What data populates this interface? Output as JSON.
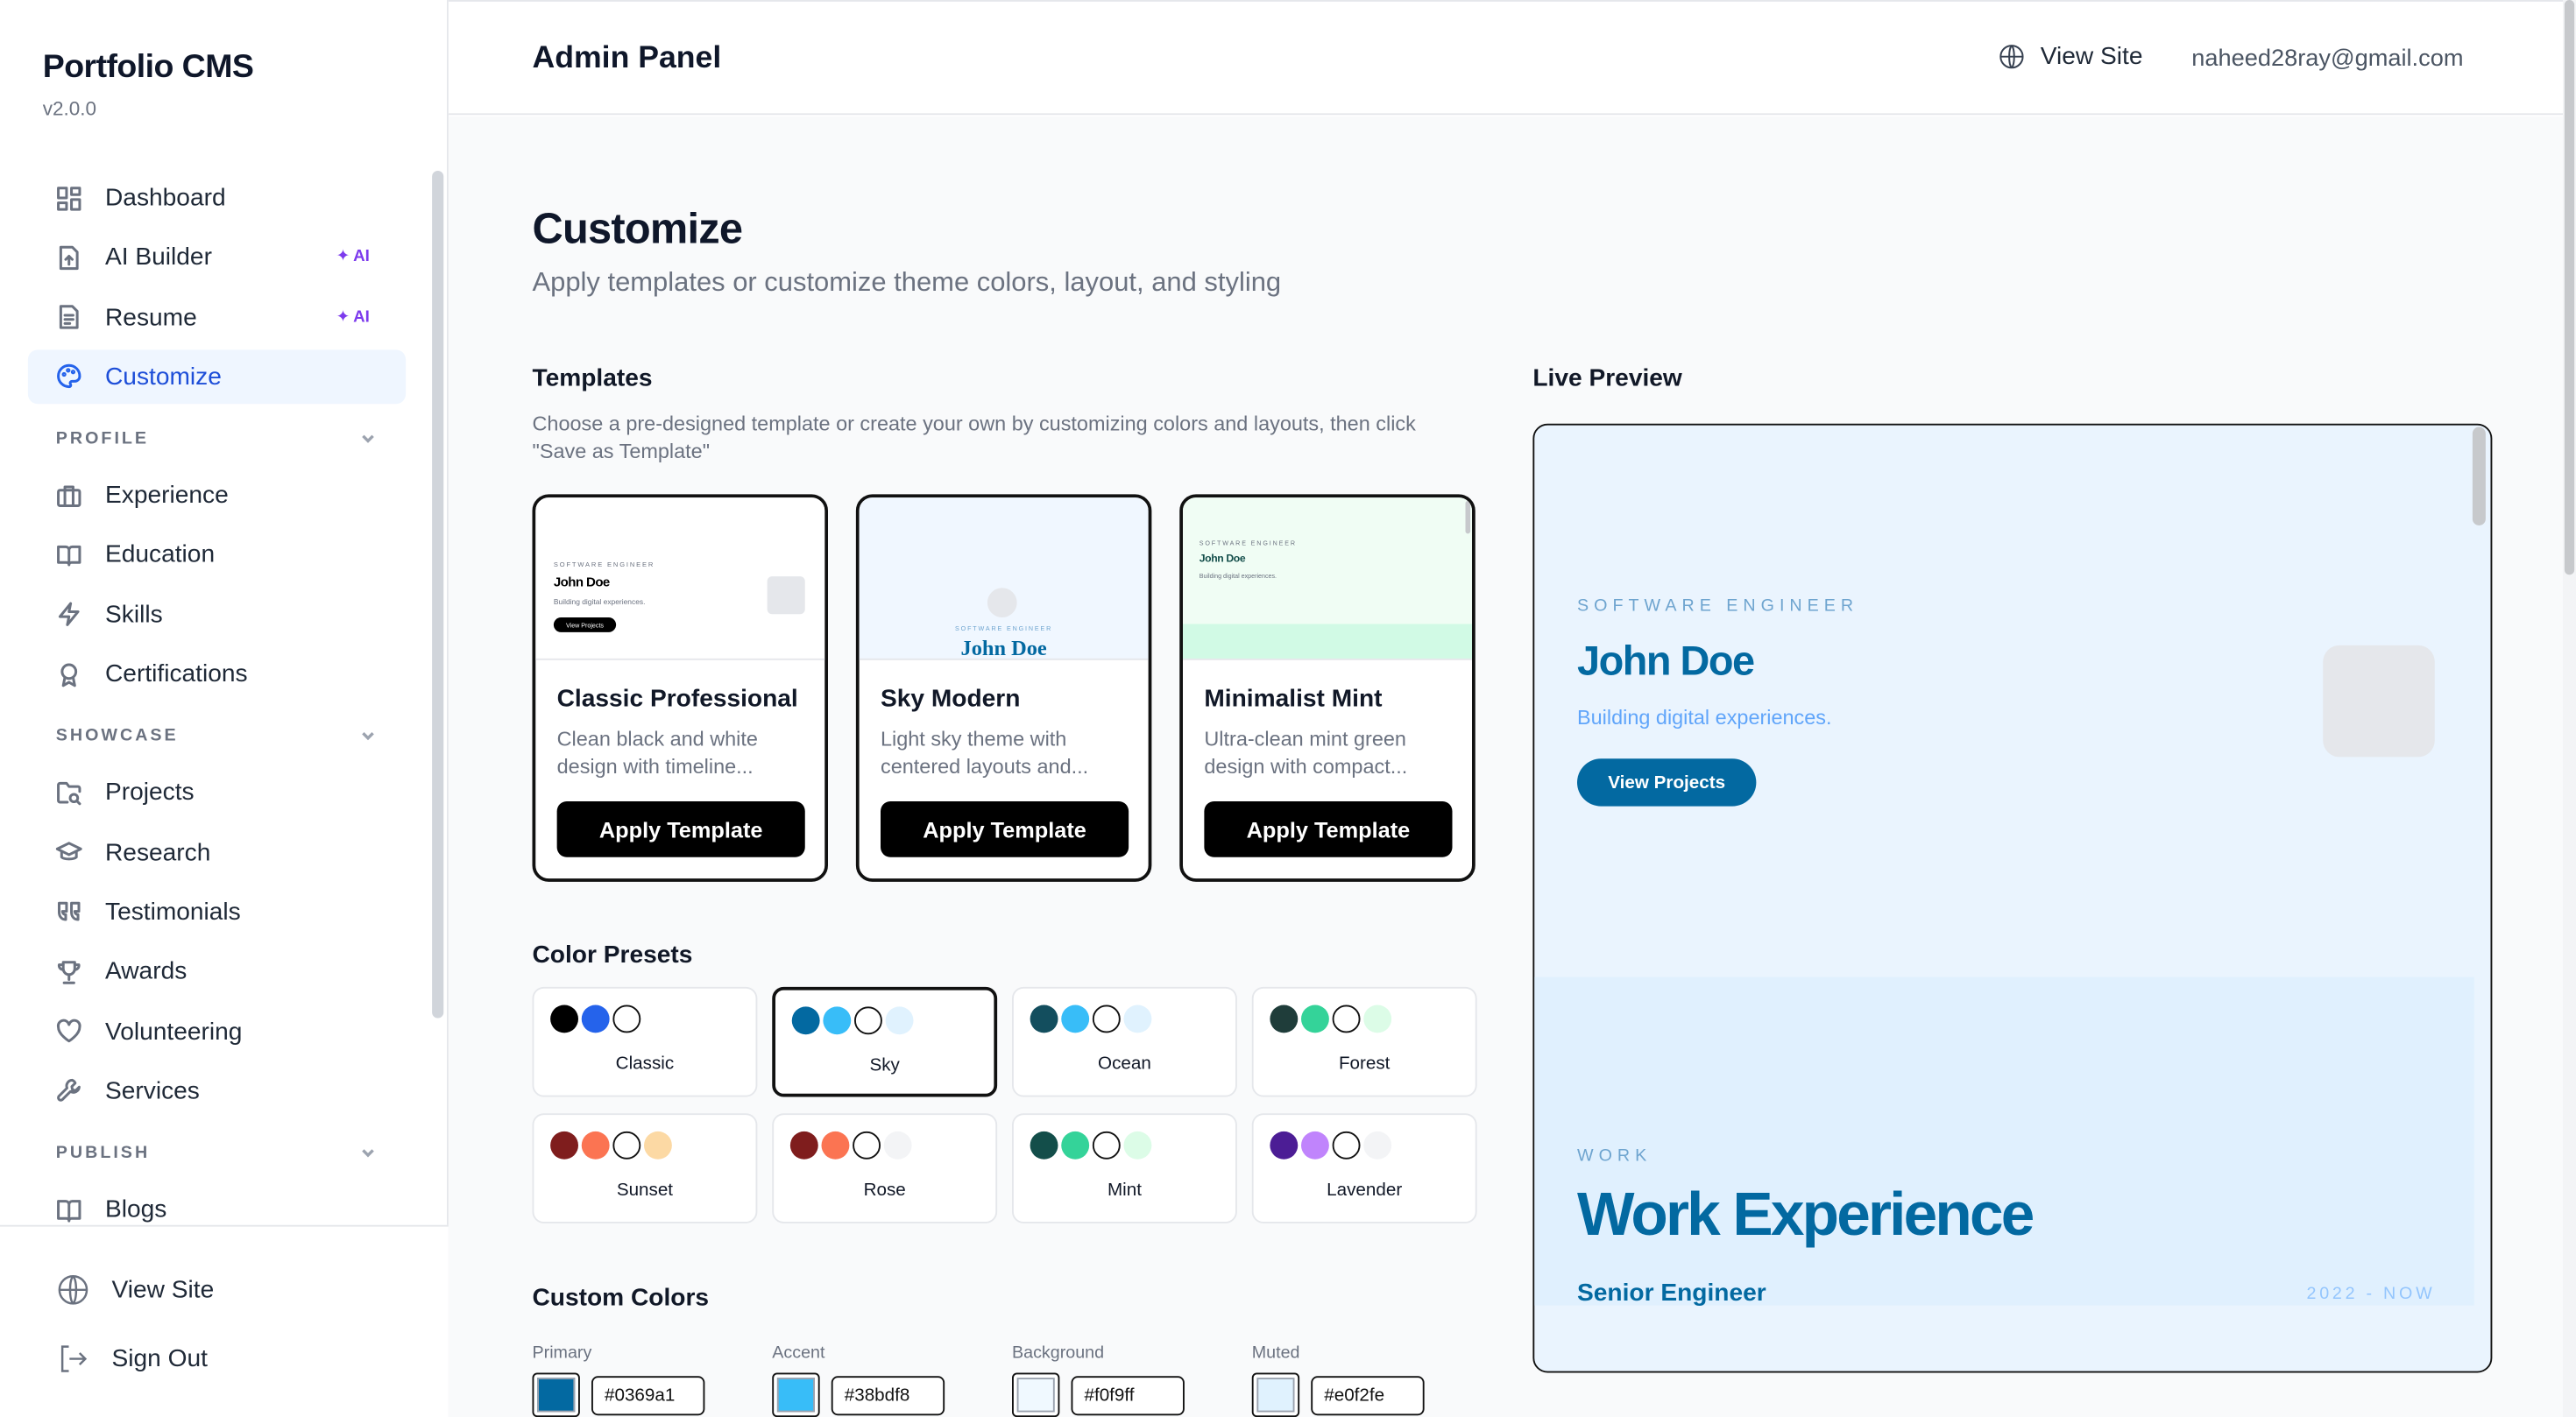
{
  "brand": {
    "title": "Portfolio CMS",
    "version": "v2.0.0"
  },
  "sidebar": {
    "top": [
      {
        "label": "Dashboard",
        "icon": "dashboard-icon"
      },
      {
        "label": "AI Builder",
        "icon": "file-upload-icon",
        "badge": "AI"
      },
      {
        "label": "Resume",
        "icon": "file-text-icon",
        "badge": "AI"
      },
      {
        "label": "Customize",
        "icon": "palette-icon",
        "active": true
      }
    ],
    "profile_label": "PROFILE",
    "profile": [
      {
        "label": "Experience",
        "icon": "briefcase-icon"
      },
      {
        "label": "Education",
        "icon": "book-icon"
      },
      {
        "label": "Skills",
        "icon": "zap-icon"
      },
      {
        "label": "Certifications",
        "icon": "award-icon"
      }
    ],
    "showcase_label": "SHOWCASE",
    "showcase": [
      {
        "label": "Projects",
        "icon": "folder-search-icon"
      },
      {
        "label": "Research",
        "icon": "graduation-cap-icon"
      },
      {
        "label": "Testimonials",
        "icon": "quote-icon"
      },
      {
        "label": "Awards",
        "icon": "trophy-icon"
      },
      {
        "label": "Volunteering",
        "icon": "heart-icon"
      },
      {
        "label": "Services",
        "icon": "wrench-icon"
      }
    ],
    "publish_label": "PUBLISH",
    "publish": [
      {
        "label": "Blogs",
        "icon": "book-open-icon"
      }
    ],
    "footer": {
      "view_site": "View Site",
      "sign_out": "Sign Out"
    }
  },
  "header": {
    "title": "Admin Panel",
    "view_site": "View Site",
    "email": "naheed28ray@gmail.com"
  },
  "page": {
    "title": "Customize",
    "subtitle": "Apply templates or customize theme colors, layout, and styling"
  },
  "templates": {
    "heading": "Templates",
    "description": "Choose a pre-designed template or create your own by customizing colors and layouts, then click \"Save as Template\"",
    "items": [
      {
        "name": "Classic Professional",
        "desc": "Clean black and white design with timeline...",
        "button": "Apply Template",
        "thumb_kicker": "SOFTWARE ENGINEER",
        "thumb_name": "John Doe",
        "thumb_tag": "Building digital experiences.",
        "thumb_btn": "View Projects"
      },
      {
        "name": "Sky Modern",
        "desc": "Light sky theme with centered layouts and...",
        "button": "Apply Template",
        "thumb_kicker": "SOFTWARE ENGINEER",
        "thumb_name": "John Doe"
      },
      {
        "name": "Minimalist Mint",
        "desc": "Ultra-clean mint green design with compact...",
        "button": "Apply Template",
        "thumb_kicker": "SOFTWARE ENGINEER",
        "thumb_name": "John Doe",
        "thumb_tag": "Building digital experiences."
      }
    ]
  },
  "presets": {
    "heading": "Color Presets",
    "items": [
      {
        "name": "Classic",
        "colors": [
          "#000000",
          "#2563eb",
          "#ffffff",
          "#ffffff"
        ]
      },
      {
        "name": "Sky",
        "colors": [
          "#0369a1",
          "#38bdf8",
          "#ffffff",
          "#e0f2fe"
        ],
        "active": true
      },
      {
        "name": "Ocean",
        "colors": [
          "#134e5e",
          "#38bdf8",
          "#ffffff",
          "#e0f2fe"
        ]
      },
      {
        "name": "Forest",
        "colors": [
          "#1f3d3a",
          "#34d399",
          "#ffffff",
          "#dcfce7"
        ]
      },
      {
        "name": "Sunset",
        "colors": [
          "#7f1d1d",
          "#fb7452",
          "#ffffff",
          "#fcd9a4"
        ]
      },
      {
        "name": "Rose",
        "colors": [
          "#7f1d1d",
          "#fb7452",
          "#ffffff",
          "#f3f4f6"
        ]
      },
      {
        "name": "Mint",
        "colors": [
          "#134e4a",
          "#34d399",
          "#ffffff",
          "#dcfce7"
        ]
      },
      {
        "name": "Lavender",
        "colors": [
          "#4c1d95",
          "#c084fc",
          "#ffffff",
          "#f3f4f6"
        ]
      }
    ]
  },
  "custom_colors": {
    "heading": "Custom Colors",
    "fields": [
      {
        "label": "Primary",
        "value": "#0369a1"
      },
      {
        "label": "Accent",
        "value": "#38bdf8"
      },
      {
        "label": "Background",
        "value": "#f0f9ff"
      },
      {
        "label": "Muted",
        "value": "#e0f2fe"
      }
    ]
  },
  "preview": {
    "heading": "Live Preview",
    "kicker": "SOFTWARE ENGINEER",
    "name": "John Doe",
    "tagline": "Building digital experiences.",
    "button": "View Projects",
    "work_kicker": "WORK",
    "work_title": "Work Experience",
    "role": "Senior Engineer",
    "date": "2022 - NOW"
  },
  "colors": {
    "accent": "#2563eb",
    "primary": "#0369a1",
    "ai_badge": "#7c3aed"
  }
}
